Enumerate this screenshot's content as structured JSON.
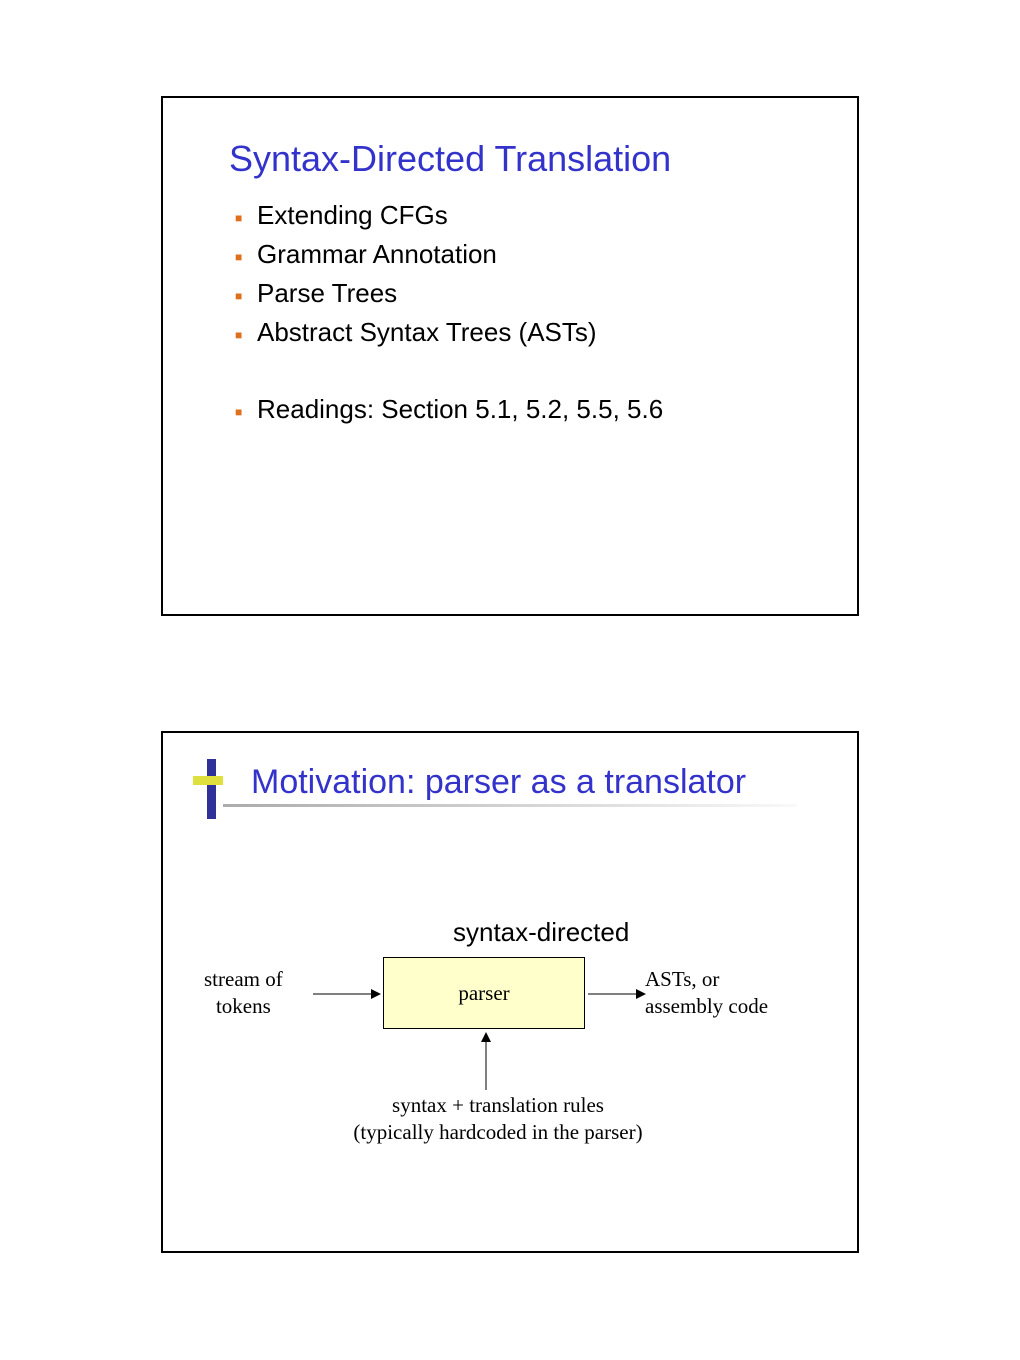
{
  "slide1": {
    "title": "Syntax-Directed Translation",
    "bullets": [
      "Extending CFGs",
      "Grammar Annotation",
      "Parse Trees",
      "Abstract Syntax Trees (ASTs)"
    ],
    "readings": "Readings: Section 5.1, 5.2, 5.5, 5.6"
  },
  "slide2": {
    "title": "Motivation: parser as a translator",
    "syntax_directed_label": "syntax-directed",
    "left_label_line1": "stream of",
    "left_label_line2": "tokens",
    "parser_box": "parser",
    "right_label_line1": "ASTs, or",
    "right_label_line2": "assembly code",
    "bottom_label_line1": "syntax + translation rules",
    "bottom_label_line2": "(typically hardcoded in the parser)"
  }
}
